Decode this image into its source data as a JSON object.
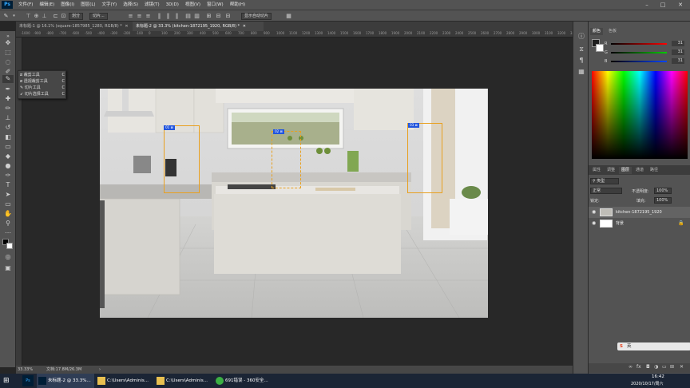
{
  "app": {
    "logo": "Ps"
  },
  "menu": [
    "文件(F)",
    "编辑(E)",
    "图像(I)",
    "图层(L)",
    "文字(Y)",
    "选择(S)",
    "滤镜(T)",
    "3D(D)",
    "视图(V)",
    "窗口(W)",
    "帮助(H)"
  ],
  "window_controls": {
    "minimize": "–",
    "maximize": "□",
    "close": "✕"
  },
  "options_bar": {
    "slice_from": "切片...",
    "show_auto_slices": "显示自动切片",
    "btn_divide": "划分"
  },
  "tabs": [
    {
      "label": "未标题-1 @ 16.1% (square-1857985_1280, RGB/8) *",
      "close": "✕",
      "active": false
    },
    {
      "label": "未标题-2 @ 33.3% (kitchen-1872195_1920, RGB/8) *",
      "close": "✕",
      "active": true
    }
  ],
  "ruler_ticks": [
    "-1000",
    "-900",
    "-800",
    "-700",
    "-600",
    "-500",
    "-400",
    "-300",
    "-200",
    "-100",
    "0",
    "100",
    "200",
    "300",
    "400",
    "500",
    "600",
    "700",
    "800",
    "900",
    "1000",
    "1100",
    "1200",
    "1300",
    "1400",
    "1500",
    "1600",
    "1700",
    "1800",
    "1900",
    "2000",
    "2100",
    "2200",
    "2300",
    "2400",
    "2500",
    "2600",
    "2700",
    "2800",
    "2900",
    "3000",
    "3100",
    "3200",
    "3300"
  ],
  "flyout": {
    "items": [
      {
        "label": "裁剪工具",
        "key": "C"
      },
      {
        "label": "透视裁剪工具",
        "key": "C"
      },
      {
        "label": "切片工具",
        "key": "C"
      },
      {
        "label": "切片选择工具",
        "key": "C"
      }
    ]
  },
  "slices": [
    {
      "label": "01 ⊠"
    },
    {
      "label": "02 ⊠"
    },
    {
      "label": "03 ⊠"
    }
  ],
  "status": {
    "zoom": "33.33%",
    "doc": "文档:17.8M/26.3M",
    "arrow": "›"
  },
  "color_panel": {
    "tabs": [
      "颜色",
      "色板"
    ],
    "channels": [
      {
        "label": "R",
        "value": "31",
        "color": "#ff0000"
      },
      {
        "label": "G",
        "value": "31",
        "color": "#00cc00"
      },
      {
        "label": "B",
        "value": "31",
        "color": "#0044ff"
      }
    ]
  },
  "layers_panel": {
    "tabs": [
      "属性",
      "调整",
      "图层",
      "通道",
      "路径"
    ],
    "kind_filter": "类型",
    "blend_mode": "正常",
    "opacity_label": "不透明度:",
    "opacity_value": "100%",
    "lock_label": "锁定:",
    "fill_label": "填充:",
    "fill_value": "100%",
    "layers": [
      {
        "name": "kitchen-1872195_1920",
        "selected": true
      },
      {
        "name": "背景",
        "selected": false
      }
    ]
  },
  "ime_bar": {
    "label": "英"
  },
  "taskbar": {
    "items": [
      {
        "label": "未标题-2 @ 33.3%..."
      },
      {
        "label": "C:\\Users\\Adminis..."
      },
      {
        "label": "C:\\Users\\Adminis..."
      },
      {
        "label": "691错误 - 360安全..."
      }
    ],
    "time": "16:42",
    "date": "2020/10/17/周六"
  },
  "colors": {
    "accent": "#31a8ff",
    "slice_line": "#e8a020",
    "slice_label": "#2255dd"
  }
}
